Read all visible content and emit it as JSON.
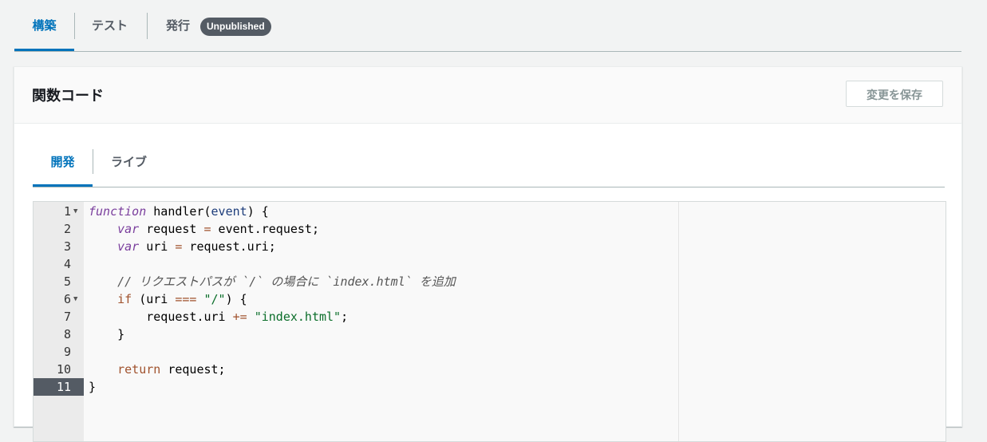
{
  "top_tabs": [
    {
      "label": "構築",
      "active": true
    },
    {
      "label": "テスト",
      "active": false
    },
    {
      "label": "発行",
      "active": false
    }
  ],
  "publish_status": "Unpublished",
  "panel": {
    "title": "関数コード",
    "save_label": "変更を保存"
  },
  "inner_tabs": [
    {
      "label": "開発",
      "active": true
    },
    {
      "label": "ライブ",
      "active": false
    }
  ],
  "editor": {
    "active_line": 11,
    "line_numbers": [
      "1",
      "2",
      "3",
      "4",
      "5",
      "6",
      "7",
      "8",
      "9",
      "10",
      "11"
    ],
    "code_lines": [
      "function handler(event) {",
      "    var request = event.request;",
      "    var uri = request.uri;",
      "",
      "    // リクエストパスが `/` の場合に `index.html` を追加",
      "    if (uri === \"/\") {",
      "        request.uri += \"index.html\";",
      "    }",
      "",
      "    return request;",
      "}"
    ]
  },
  "colors": {
    "accent": "#0073bb",
    "badge": "#545b64",
    "keyword": "#7a3e9d",
    "string": "#0b6e2a"
  }
}
